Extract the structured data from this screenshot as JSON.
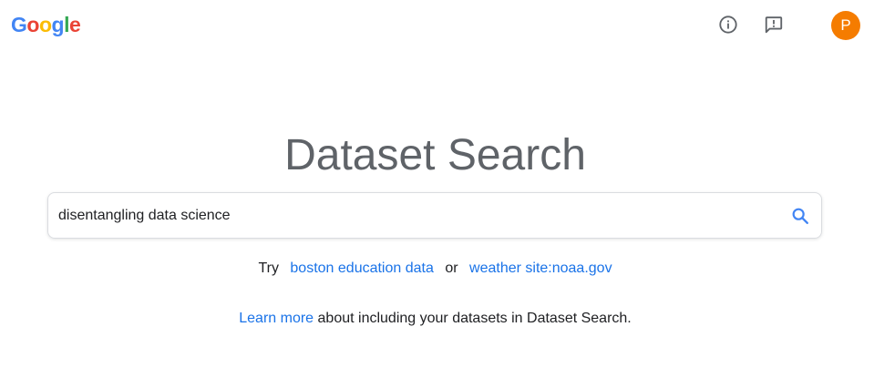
{
  "header": {
    "logo": {
      "letters": [
        "G",
        "o",
        "o",
        "g",
        "l",
        "e"
      ],
      "colors": [
        "#4285f4",
        "#ea4335",
        "#fbbc05",
        "#4285f4",
        "#34a853",
        "#ea4335"
      ]
    },
    "info_icon": "info-icon",
    "feedback_icon": "feedback-icon",
    "avatar": {
      "initial": "P",
      "color": "#f57c00"
    }
  },
  "title": "Dataset Search",
  "search": {
    "value": "disentangling data science",
    "icon": "search-icon",
    "accent": "#4285f4"
  },
  "suggestions": {
    "prefix": "Try",
    "first": "boston education data",
    "separator": "or",
    "second": "weather site:noaa.gov"
  },
  "learn": {
    "link": "Learn more",
    "text": "about including your datasets in Dataset Search."
  },
  "colors": {
    "link": "#1a73e8",
    "title": "#5f6368"
  }
}
